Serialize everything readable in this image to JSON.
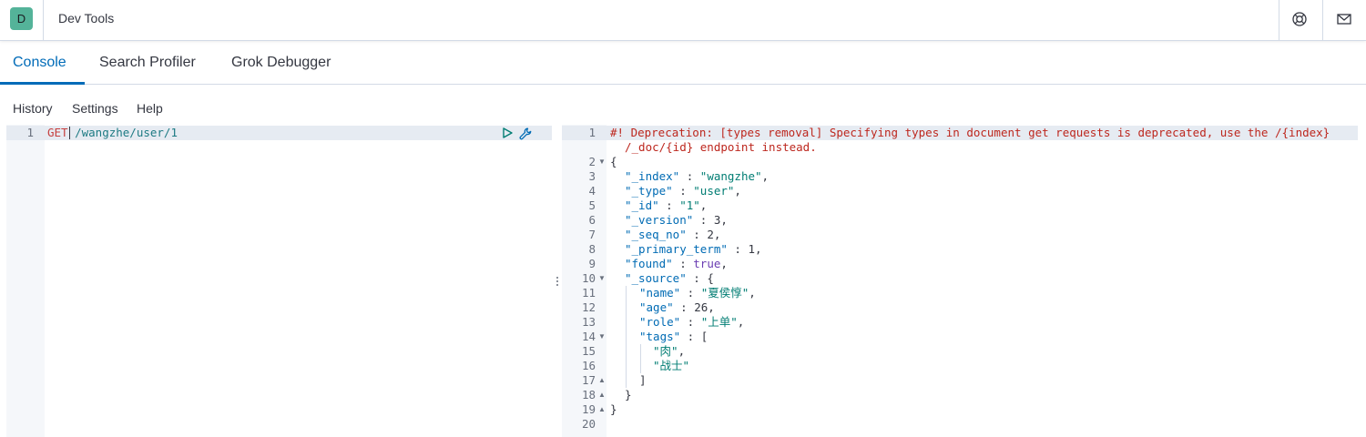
{
  "header": {
    "logo_letter": "D",
    "title": "Dev Tools",
    "icons": [
      "help-icon",
      "mail-icon"
    ]
  },
  "tabs": [
    {
      "label": "Console",
      "active": true
    },
    {
      "label": "Search Profiler",
      "active": false
    },
    {
      "label": "Grok Debugger",
      "active": false
    }
  ],
  "toolbar": {
    "history": "History",
    "settings": "Settings",
    "help": "Help"
  },
  "request_editor": {
    "line_number": "1",
    "method": "GET",
    "url": " /wangzhe/user/1",
    "actions": [
      "play-icon",
      "wrench-icon"
    ]
  },
  "response_editor": {
    "line_numbers": [
      "1",
      "2",
      "3",
      "4",
      "5",
      "6",
      "7",
      "8",
      "9",
      "10",
      "11",
      "12",
      "13",
      "14",
      "15",
      "16",
      "17",
      "18",
      "19",
      "20"
    ],
    "warning_line_1": "#! Deprecation: [types removal] Specifying types in document get requests is deprecated, use the /{index}",
    "warning_line_2": "/_doc/{id} endpoint instead.",
    "l2": "{",
    "l3": {
      "key": "\"_index\"",
      "sep": " : ",
      "val": "\"wangzhe\"",
      "end": ","
    },
    "l4": {
      "key": "\"_type\"",
      "sep": " : ",
      "val": "\"user\"",
      "end": ","
    },
    "l5": {
      "key": "\"_id\"",
      "sep": " : ",
      "val": "\"1\"",
      "end": ","
    },
    "l6": {
      "key": "\"_version\"",
      "sep": " : ",
      "val": "3",
      "end": ","
    },
    "l7": {
      "key": "\"_seq_no\"",
      "sep": " : ",
      "val": "2",
      "end": ","
    },
    "l8": {
      "key": "\"_primary_term\"",
      "sep": " : ",
      "val": "1",
      "end": ","
    },
    "l9": {
      "key": "\"found\"",
      "sep": " : ",
      "val": "true",
      "end": ","
    },
    "l10": {
      "key": "\"_source\"",
      "sep": " : ",
      "end": "{"
    },
    "l11": {
      "key": "\"name\"",
      "sep": " : ",
      "val": "\"夏侯惇\"",
      "end": ","
    },
    "l12": {
      "key": "\"age\"",
      "sep": " : ",
      "val": "26",
      "end": ","
    },
    "l13": {
      "key": "\"role\"",
      "sep": " : ",
      "val": "\"上单\"",
      "end": ","
    },
    "l14": {
      "key": "\"tags\"",
      "sep": " : ",
      "end": "["
    },
    "l15": {
      "val": "\"肉\"",
      "end": ","
    },
    "l16": {
      "val": "\"战士\""
    },
    "l17": "]",
    "l18": "}",
    "l19": "}"
  }
}
